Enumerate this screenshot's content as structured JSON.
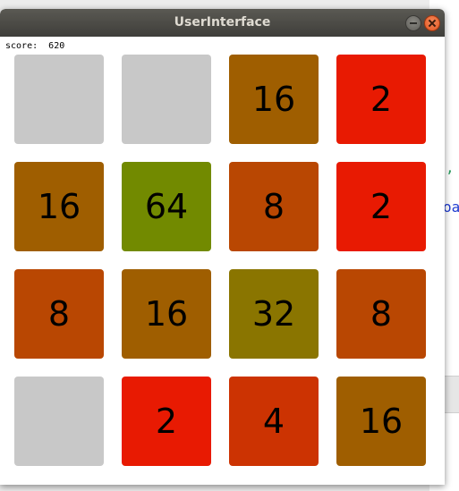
{
  "window": {
    "title": "UserInterface"
  },
  "game": {
    "score_label": "score:",
    "score_value": "620",
    "board": [
      [
        null,
        null,
        16,
        2
      ],
      [
        16,
        64,
        8,
        2
      ],
      [
        8,
        16,
        32,
        8
      ],
      [
        null,
        2,
        4,
        16
      ]
    ],
    "tile_colors": {
      "empty": "#c8c8c8",
      "2": "#e81a02",
      "4": "#cc3302",
      "8": "#b94702",
      "16": "#9f5e00",
      "32": "#8a7500",
      "64": "#728a00"
    }
  },
  "background": {
    "glyph_1": ",",
    "glyph_2": "oa"
  }
}
